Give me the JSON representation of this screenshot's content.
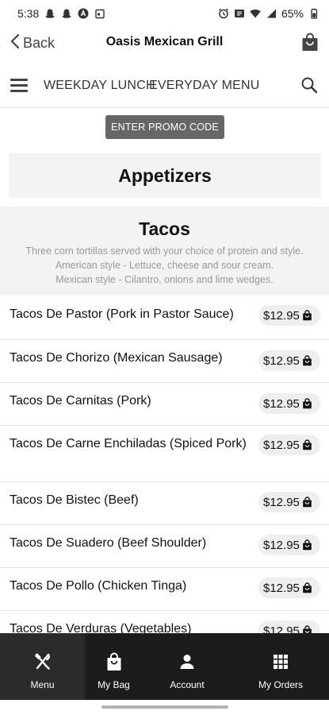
{
  "status_bar": {
    "time": "5:38",
    "battery": "65%"
  },
  "nav": {
    "back_label": "Back",
    "title": "Oasis Mexican Grill"
  },
  "tabs": [
    {
      "label": "WEEKDAY LUNCH"
    },
    {
      "label": "EVERYDAY MENU"
    }
  ],
  "promo": {
    "label": "ENTER PROMO CODE"
  },
  "category": {
    "title": "Appetizers"
  },
  "section": {
    "title": "Tacos",
    "description": [
      "Three corn tortillas served with your choice of protein and style.",
      "American style - Lettuce, cheese and sour cream.",
      "Mexican style - Cilantro, onions and lime wedges."
    ]
  },
  "items": [
    {
      "name": "Tacos De Pastor (Pork in Pastor Sauce)",
      "price": "$12.95"
    },
    {
      "name": "Tacos De Chorizo (Mexican Sausage)",
      "price": "$12.95"
    },
    {
      "name": "Tacos De Carnitas (Pork)",
      "price": "$12.95"
    },
    {
      "name": "Tacos De Carne Enchiladas (Spiced Pork)",
      "price": "$12.95"
    },
    {
      "name": "Tacos De Bistec (Beef)",
      "price": "$12.95"
    },
    {
      "name": "Tacos De Suadero (Beef Shoulder)",
      "price": "$12.95"
    },
    {
      "name": "Tacos De Pollo (Chicken Tinga)",
      "price": "$12.95"
    },
    {
      "name": "Tacos De Verduras (Vegetables)",
      "price": "$12.95"
    }
  ],
  "bottom_nav": [
    {
      "label": "Menu",
      "icon": "fork-knife-icon",
      "active": true
    },
    {
      "label": "My Bag",
      "icon": "bag-icon",
      "active": false
    },
    {
      "label": "Account",
      "icon": "person-icon",
      "active": false
    },
    {
      "label": "My Orders",
      "icon": "grid-icon",
      "active": false
    }
  ],
  "colors": {
    "promo_bg": "#666666",
    "bottom_nav_bg": "#1b1c1e",
    "bottom_nav_active": "#2a2b2d",
    "section_bg": "#f3f3f3",
    "price_pill_bg": "#eeeeee"
  }
}
